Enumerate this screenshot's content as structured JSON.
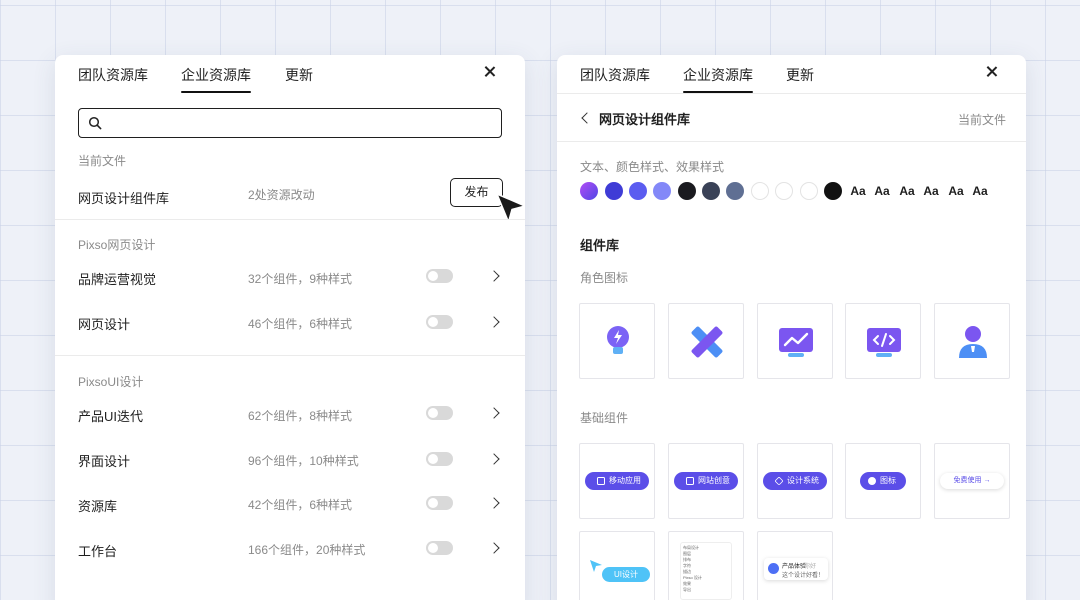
{
  "colors": {
    "accent": "#5b4ee8",
    "text": "#1f1f1f",
    "muted": "#8a8a8a",
    "toggle_off": "#d9d9d9"
  },
  "left_panel": {
    "tabs": [
      "团队资源库",
      "企业资源库",
      "更新"
    ],
    "active_tab": "企业资源库",
    "search": {
      "placeholder": "",
      "value": ""
    },
    "current_file": {
      "section_label": "当前文件",
      "name": "网页设计组件库",
      "changes": "2处资源改动",
      "publish_label": "发布"
    },
    "groups": [
      {
        "label": "Pixso网页设计",
        "items": [
          {
            "name": "品牌运营视觉",
            "meta": "32个组件，9种样式",
            "enabled": false
          },
          {
            "name": "网页设计",
            "meta": "46个组件，6种样式",
            "enabled": false
          }
        ]
      },
      {
        "label": "PixsoUI设计",
        "items": [
          {
            "name": "产品UI迭代",
            "meta": "62个组件，8种样式",
            "enabled": false
          },
          {
            "name": "界面设计",
            "meta": "96个组件，10种样式",
            "enabled": false
          },
          {
            "name": "资源库",
            "meta": "42个组件，6种样式",
            "enabled": false
          },
          {
            "name": "工作台",
            "meta": "166个组件，20种样式",
            "enabled": false
          }
        ]
      }
    ]
  },
  "right_panel": {
    "tabs": [
      "团队资源库",
      "企业资源库",
      "更新"
    ],
    "active_tab": "企业资源库",
    "library_title": "网页设计组件库",
    "current_file_label": "当前文件",
    "styles_label": "文本、颜色样式、效果样式",
    "color_swatches": [
      "#7a4df0",
      "#3f3cd6",
      "#5b5cf0",
      "#8388f8",
      "#1a1a1f",
      "#3a4257",
      "#5f6f93",
      "#ffffff",
      "#ffffff",
      "#ffffff",
      "#111111"
    ],
    "text_styles": [
      "Aa",
      "Aa",
      "Aa",
      "Aa",
      "Aa",
      "Aa"
    ],
    "components_title": "组件库",
    "role_icons_label": "角色图标",
    "role_icons": [
      "lightbulb-icon",
      "ruler-pencil-icon",
      "monitor-chart-icon",
      "code-monitor-icon",
      "user-icon"
    ],
    "basic_components_label": "基础组件",
    "basic_components": [
      "移动应用",
      "网站创意",
      "设计系统",
      "图标",
      "免费使用"
    ],
    "extra_components": [
      {
        "label": "UI设计"
      },
      {
        "rows": [
          "布局设计",
          "图层",
          "排布",
          "字符",
          "描边",
          "Pixso 设计",
          "效果",
          "导出"
        ]
      },
      {
        "title": "产品体验",
        "subtitle": "这个设计好看！",
        "tag": "你好"
      }
    ]
  }
}
